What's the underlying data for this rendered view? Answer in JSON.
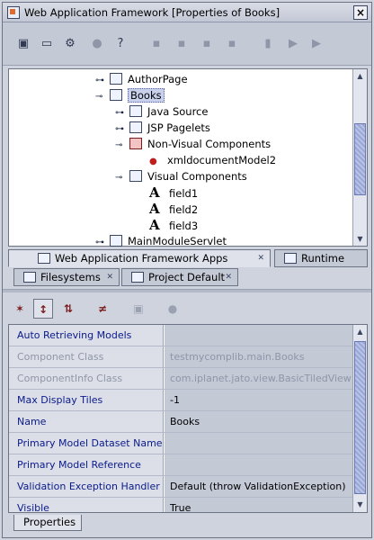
{
  "window": {
    "title": "Web Application Framework [Properties of Books]"
  },
  "toolbar": {
    "icons": [
      "new-page-icon",
      "open-icon",
      "tools-icon",
      "disabled-icon",
      "help-icon",
      "step-icon",
      "stop-icon",
      "pause-icon",
      "square-icon",
      "step-into-icon",
      "run-icon",
      "debug-icon"
    ]
  },
  "tree": {
    "items": [
      {
        "label": "AuthorPage",
        "depth": 0,
        "expanded": false,
        "icon": "page-icon"
      },
      {
        "label": "Books",
        "depth": 0,
        "expanded": true,
        "selected": true,
        "icon": "page-icon"
      },
      {
        "label": "Java Source",
        "depth": 1,
        "expanded": false,
        "icon": "java-source-icon"
      },
      {
        "label": "JSP Pagelets",
        "depth": 1,
        "expanded": false,
        "icon": "folder-icon"
      },
      {
        "label": "Non-Visual Components",
        "depth": 1,
        "expanded": true,
        "icon": "nonvisual-folder-icon"
      },
      {
        "label": "xmldocumentModel2",
        "depth": 2,
        "icon": "bean-icon"
      },
      {
        "label": "Visual Components",
        "depth": 1,
        "expanded": true,
        "icon": "folder-icon"
      },
      {
        "label": "field1",
        "depth": 2,
        "icon": "field-icon"
      },
      {
        "label": "field2",
        "depth": 2,
        "icon": "field-icon"
      },
      {
        "label": "field3",
        "depth": 2,
        "icon": "field-icon"
      },
      {
        "label": "MainModuleServlet",
        "depth": 0,
        "expanded": false,
        "icon": "servlet-icon"
      }
    ]
  },
  "tabs_row1": [
    {
      "label": "Web Application Framework Apps",
      "active": true
    },
    {
      "label": "Runtime",
      "active": false
    }
  ],
  "tabs_row2": [
    {
      "label": "Filesystems",
      "active": false
    },
    {
      "label": "Project Default",
      "active": false
    }
  ],
  "glyphs": {
    "close": "✕",
    "field": "A"
  },
  "property_sheet": {
    "rows": [
      {
        "name": "Auto Retrieving Models",
        "value": "",
        "readonly": false
      },
      {
        "name": "Component Class",
        "value": "testmycomplib.main.Books",
        "readonly": true
      },
      {
        "name": "ComponentInfo Class",
        "value": "com.iplanet.jato.view.BasicTiledView",
        "readonly": true
      },
      {
        "name": "Max Display Tiles",
        "value": "-1",
        "readonly": false
      },
      {
        "name": "Name",
        "value": "Books",
        "readonly": false
      },
      {
        "name": "Primary Model Dataset Name",
        "value": "",
        "readonly": false
      },
      {
        "name": "Primary Model Reference",
        "value": "",
        "readonly": false
      },
      {
        "name": "Validation Exception Handler",
        "value": "Default (throw ValidationException)",
        "readonly": false
      },
      {
        "name": "Visible",
        "value": "True",
        "readonly": false
      }
    ],
    "bottom_tab": "Properties"
  },
  "colors": {
    "accent": "#0a1a8a",
    "readonly": "#8f96a8"
  }
}
